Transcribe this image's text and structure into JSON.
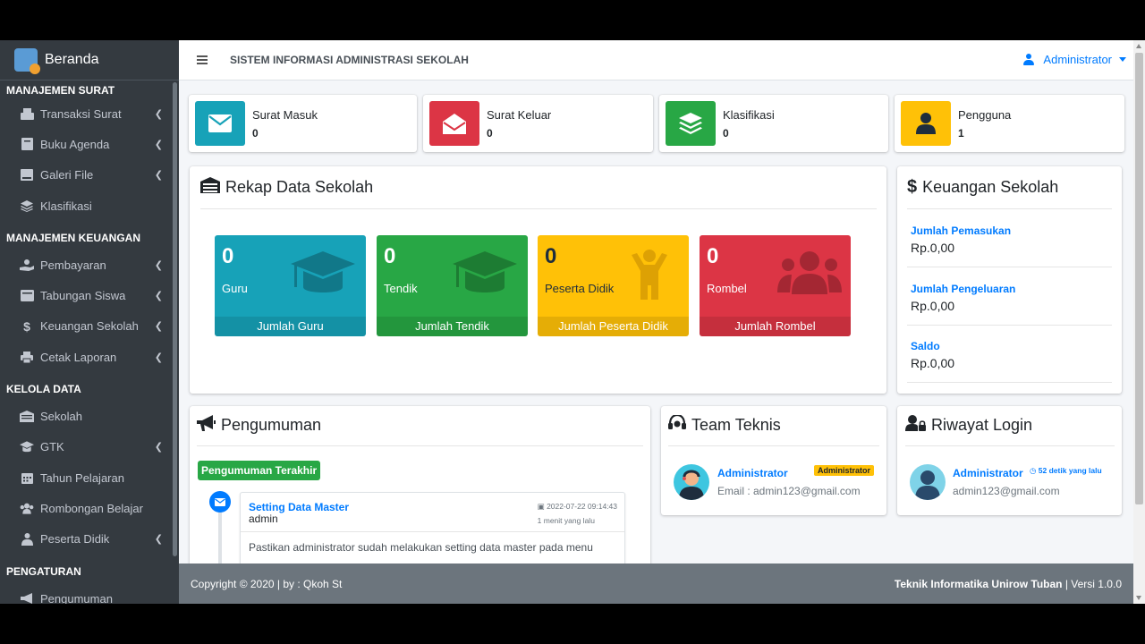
{
  "sidebar": {
    "brand": "Beranda",
    "sections": [
      {
        "header": "MANAJEMEN SURAT",
        "items": [
          {
            "label": "Transaksi Surat",
            "icon": "mail-tray-icon",
            "chevron": true
          },
          {
            "label": "Buku Agenda",
            "icon": "book-icon",
            "chevron": true
          },
          {
            "label": "Galeri File",
            "icon": "folder-icon",
            "chevron": true
          },
          {
            "label": "Klasifikasi",
            "icon": "layers-icon",
            "chevron": false
          }
        ]
      },
      {
        "header": "MANAJEMEN KEUANGAN",
        "items": [
          {
            "label": "Pembayaran",
            "icon": "hand-coin-icon",
            "chevron": true
          },
          {
            "label": "Tabungan Siswa",
            "icon": "wallet-icon",
            "chevron": true
          },
          {
            "label": "Keuangan Sekolah",
            "icon": "dollar-icon",
            "chevron": true
          },
          {
            "label": "Cetak Laporan",
            "icon": "printer-icon",
            "chevron": true
          }
        ]
      },
      {
        "header": "KELOLA DATA",
        "items": [
          {
            "label": "Sekolah",
            "icon": "school-icon",
            "chevron": false
          },
          {
            "label": "GTK",
            "icon": "graduation-cap-icon",
            "chevron": true
          },
          {
            "label": "Tahun Pelajaran",
            "icon": "calendar-icon",
            "chevron": false
          },
          {
            "label": "Rombongan Belajar",
            "icon": "users-icon",
            "chevron": false
          },
          {
            "label": "Peserta Didik",
            "icon": "student-icon",
            "chevron": true
          }
        ]
      },
      {
        "header": "PENGATURAN",
        "items": [
          {
            "label": "Pengumuman",
            "icon": "megaphone-icon",
            "chevron": false
          }
        ]
      }
    ]
  },
  "navbar": {
    "title": "SISTEM INFORMASI ADMINISTRASI SEKOLAH",
    "user": "Administrator"
  },
  "info_boxes": [
    {
      "label": "Surat Masuk",
      "value": "0",
      "color": "#17a2b8",
      "icon": "envelope-icon"
    },
    {
      "label": "Surat Keluar",
      "value": "0",
      "color": "#dc3545",
      "icon": "envelope-open-icon"
    },
    {
      "label": "Klasifikasi",
      "value": "0",
      "color": "#28a745",
      "icon": "layers-icon"
    },
    {
      "label": "Pengguna",
      "value": "1",
      "color": "#ffc107",
      "icon": "user-icon"
    }
  ],
  "rekap": {
    "title": "Rekap Data Sekolah",
    "boxes": [
      {
        "value": "0",
        "caption": "Guru",
        "footer": "Jumlah Guru",
        "color": "#17a2b8",
        "icon": "graduation-cap-icon"
      },
      {
        "value": "0",
        "caption": "Tendik",
        "footer": "Jumlah Tendik",
        "color": "#28a745",
        "icon": "graduation-cap-icon"
      },
      {
        "value": "0",
        "caption": "Peserta Didik",
        "footer": "Jumlah Peserta Didik",
        "color": "#ffc107",
        "icon": "child-icon"
      },
      {
        "value": "0",
        "caption": "Rombel",
        "footer": "Jumlah Rombel",
        "color": "#dc3545",
        "icon": "users-icon"
      }
    ]
  },
  "keuangan": {
    "title": "Keuangan Sekolah",
    "rows": [
      {
        "label": "Jumlah Pemasukan",
        "value": "Rp.0,00"
      },
      {
        "label": "Jumlah Pengeluaran",
        "value": "Rp.0,00"
      },
      {
        "label": "Saldo",
        "value": "Rp.0,00"
      }
    ]
  },
  "pengumuman": {
    "title": "Pengumuman",
    "badge": "Pengumuman Terakhir",
    "item": {
      "title": "Setting Data Master",
      "author": "admin",
      "datetime": "2022-07-22 09:14:43",
      "ago": "1 menit yang lalu",
      "body": "Pastikan administrator sudah melakukan setting data master pada menu"
    }
  },
  "team": {
    "title": "Team Teknis",
    "name": "Administrator",
    "role": "Administrator",
    "email": "Email : admin123@gmail.com"
  },
  "riwayat": {
    "title": "Riwayat Login",
    "name": "Administrator",
    "time": "52 detik yang lalu",
    "email": "admin123@gmail.com"
  },
  "footer": {
    "left": "Copyright © 2020 | by : Qkoh St",
    "right_bold": "Teknik Informatika Unirow Tuban",
    "right_rest": " | Versi 1.0.0"
  }
}
